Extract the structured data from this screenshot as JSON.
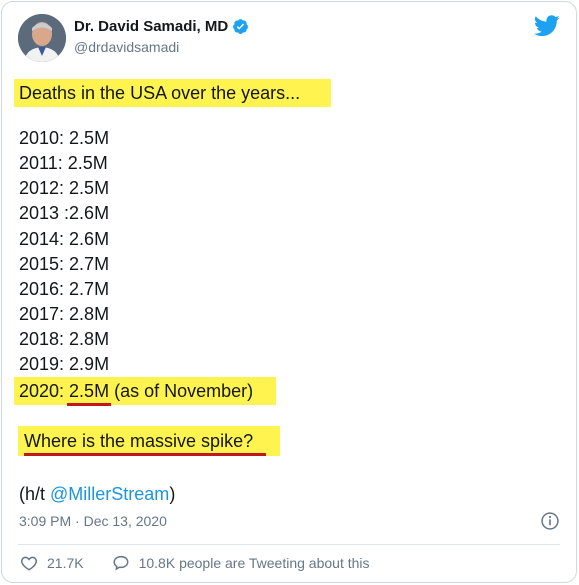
{
  "author": {
    "name": "Dr. David Samadi, MD",
    "handle": "@drdavidsamadi",
    "verified": true
  },
  "tweet": {
    "heading": "Deaths in the USA over the years...",
    "years": [
      "2010: 2.5M",
      "2011: 2.5M",
      "2012: 2.5M",
      "2013 :2.6M",
      "2014: 2.6M",
      "2015: 2.7M",
      "2016: 2.7M",
      "2017: 2.8M",
      "2018: 2.8M",
      "2019: 2.9M"
    ],
    "final_year_prefix": "2020: ",
    "final_year_value": "2.5M",
    "final_year_suffix": " (as of November)",
    "question": "Where is the massive spike?",
    "credit_prefix": "(h/t ",
    "credit_mention": "@MillerStream",
    "credit_suffix": ")"
  },
  "meta": {
    "timestamp": "3:09 PM · Dec 13, 2020",
    "likes": "21.7K",
    "conversation": "10.8K people are Tweeting about this"
  },
  "colors": {
    "highlight": "#fff44f",
    "underline": "#c0181b",
    "link": "#1b95e0",
    "twitter_blue": "#1da1f2"
  },
  "icons": [
    "avatar",
    "verified-badge-icon",
    "twitter-bird-icon",
    "info-icon",
    "heart-icon",
    "speech-bubble-icon"
  ]
}
